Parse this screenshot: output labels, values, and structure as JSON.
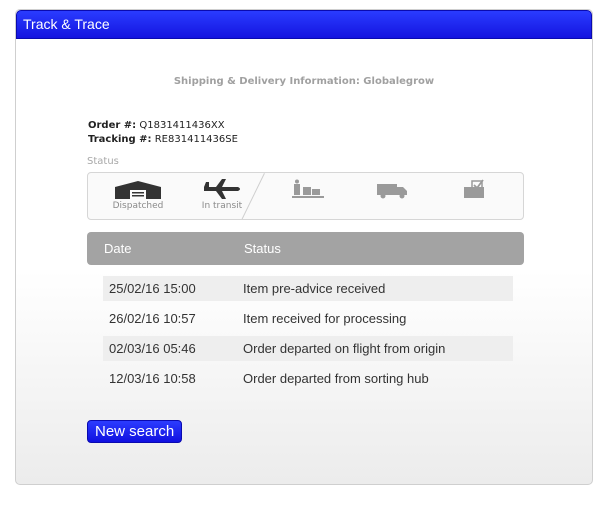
{
  "header": {
    "title": "Track & Trace"
  },
  "shipping_info": "Shipping & Delivery Information: Globalegrow",
  "order": {
    "label": "Order #:",
    "value": "Q1831411436XX"
  },
  "tracking": {
    "label": "Tracking #:",
    "value": "RE831411436SE"
  },
  "status_label": "Status",
  "steps": [
    {
      "label": "Dispatched",
      "icon": "warehouse-icon"
    },
    {
      "label": "In transit",
      "icon": "airplane-icon"
    },
    {
      "label": "",
      "icon": "customs-icon"
    },
    {
      "label": "",
      "icon": "delivery-truck-icon"
    },
    {
      "label": "",
      "icon": "delivered-box-icon"
    }
  ],
  "table": {
    "headers": [
      "Date",
      "Status"
    ],
    "rows": [
      {
        "date": "25/02/16 15:00",
        "status": "Item pre-advice received"
      },
      {
        "date": "26/02/16 10:57",
        "status": "Item received for processing"
      },
      {
        "date": "02/03/16 05:46",
        "status": "Order departed on flight from origin"
      },
      {
        "date": "12/03/16 10:58",
        "status": "Order departed from sorting hub"
      }
    ]
  },
  "new_search_label": "New search",
  "colors": {
    "header_blue": "#1f2cf0",
    "table_header": "#a3a3a3",
    "active_icon": "#333333",
    "inactive_icon": "#9a9a9a"
  }
}
